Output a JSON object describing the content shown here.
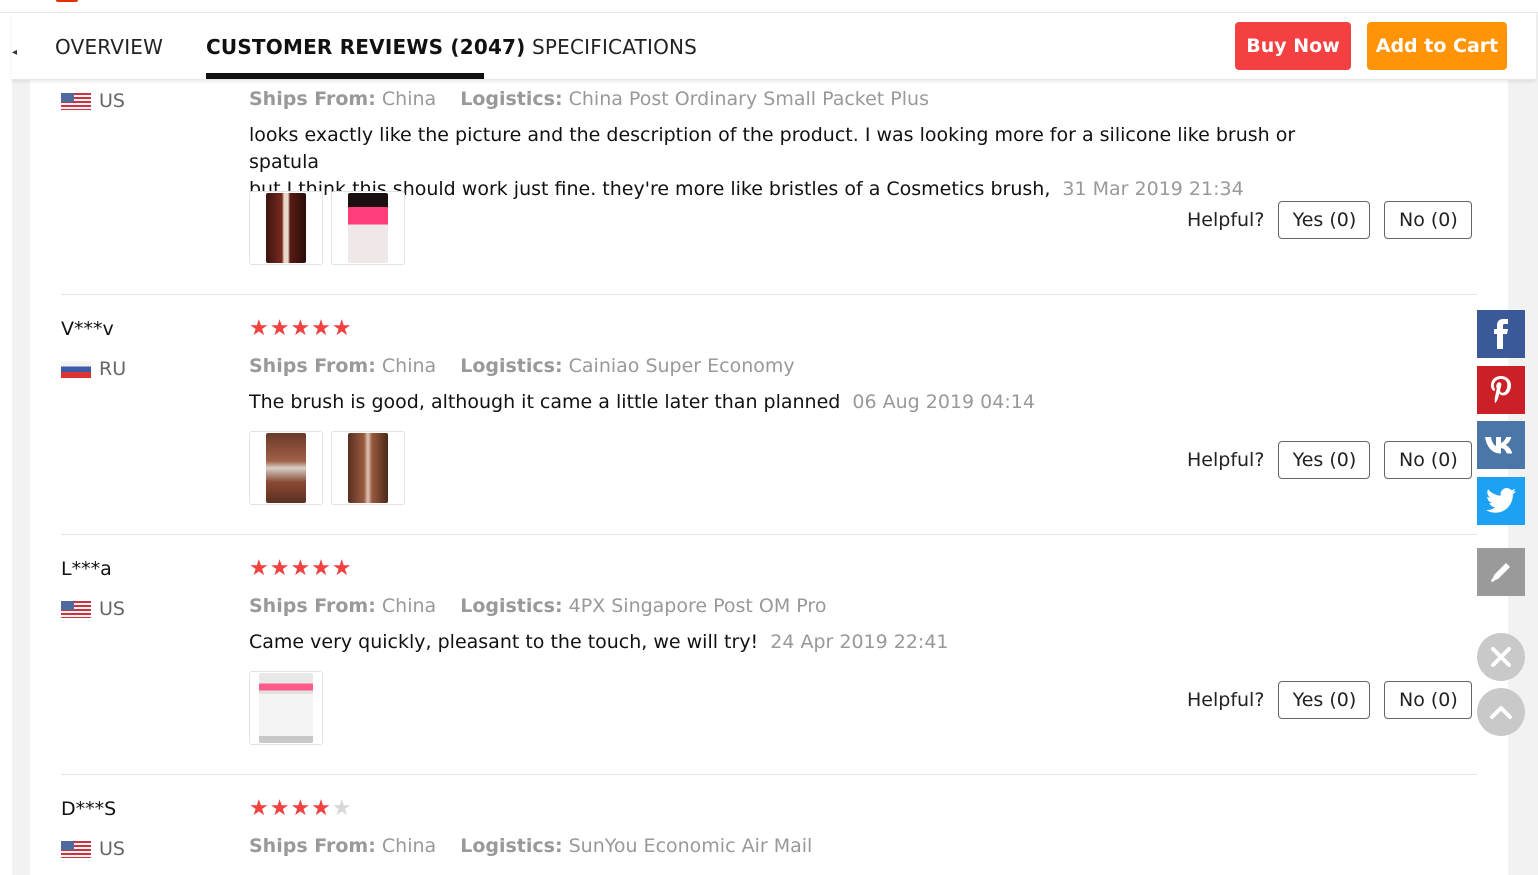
{
  "tabs": {
    "overview": "OVERVIEW",
    "reviews": "CUSTOMER REVIEWS (2047)",
    "specs": "SPECIFICATIONS"
  },
  "actions": {
    "buy_now": "Buy Now",
    "add_to_cart": "Add to Cart"
  },
  "labels": {
    "ships_from": "Ships From:",
    "logistics": "Logistics:",
    "helpful": "Helpful?"
  },
  "reviews": [
    {
      "country": "US",
      "ships_from": "China",
      "logistics": "China Post Ordinary Small Packet Plus",
      "text_line1": "looks exactly like the picture and the description of the product. I was looking more for a silicone like brush or spatula",
      "text_line2": "but I think this should work just fine. they're more like bristles of a Cosmetics brush,",
      "date": "31 Mar 2019 21:34",
      "yes": "Yes (0)",
      "no": "No (0)"
    },
    {
      "user": "V***v",
      "rating": 5,
      "country": "RU",
      "ships_from": "China",
      "logistics": "Cainiao Super Economy",
      "text": "The brush is good, although it came a little later than planned",
      "date": "06 Aug 2019 04:14",
      "yes": "Yes (0)",
      "no": "No (0)"
    },
    {
      "user": "L***a",
      "rating": 5,
      "country": "US",
      "ships_from": "China",
      "logistics": "4PX Singapore Post OM Pro",
      "text": "Came very quickly, pleasant to the touch, we will try!",
      "date": "24 Apr 2019 22:41",
      "yes": "Yes (0)",
      "no": "No (0)"
    },
    {
      "user": "D***S",
      "rating": 4,
      "country": "US",
      "ships_from": "China",
      "logistics": "SunYou Economic Air Mail"
    }
  ],
  "social": [
    "facebook-icon",
    "pinterest-icon",
    "vk-icon",
    "twitter-icon",
    "edit-icon"
  ],
  "colors": {
    "buy": "#f44040",
    "cart": "#ff9408",
    "star": "#f14141"
  }
}
